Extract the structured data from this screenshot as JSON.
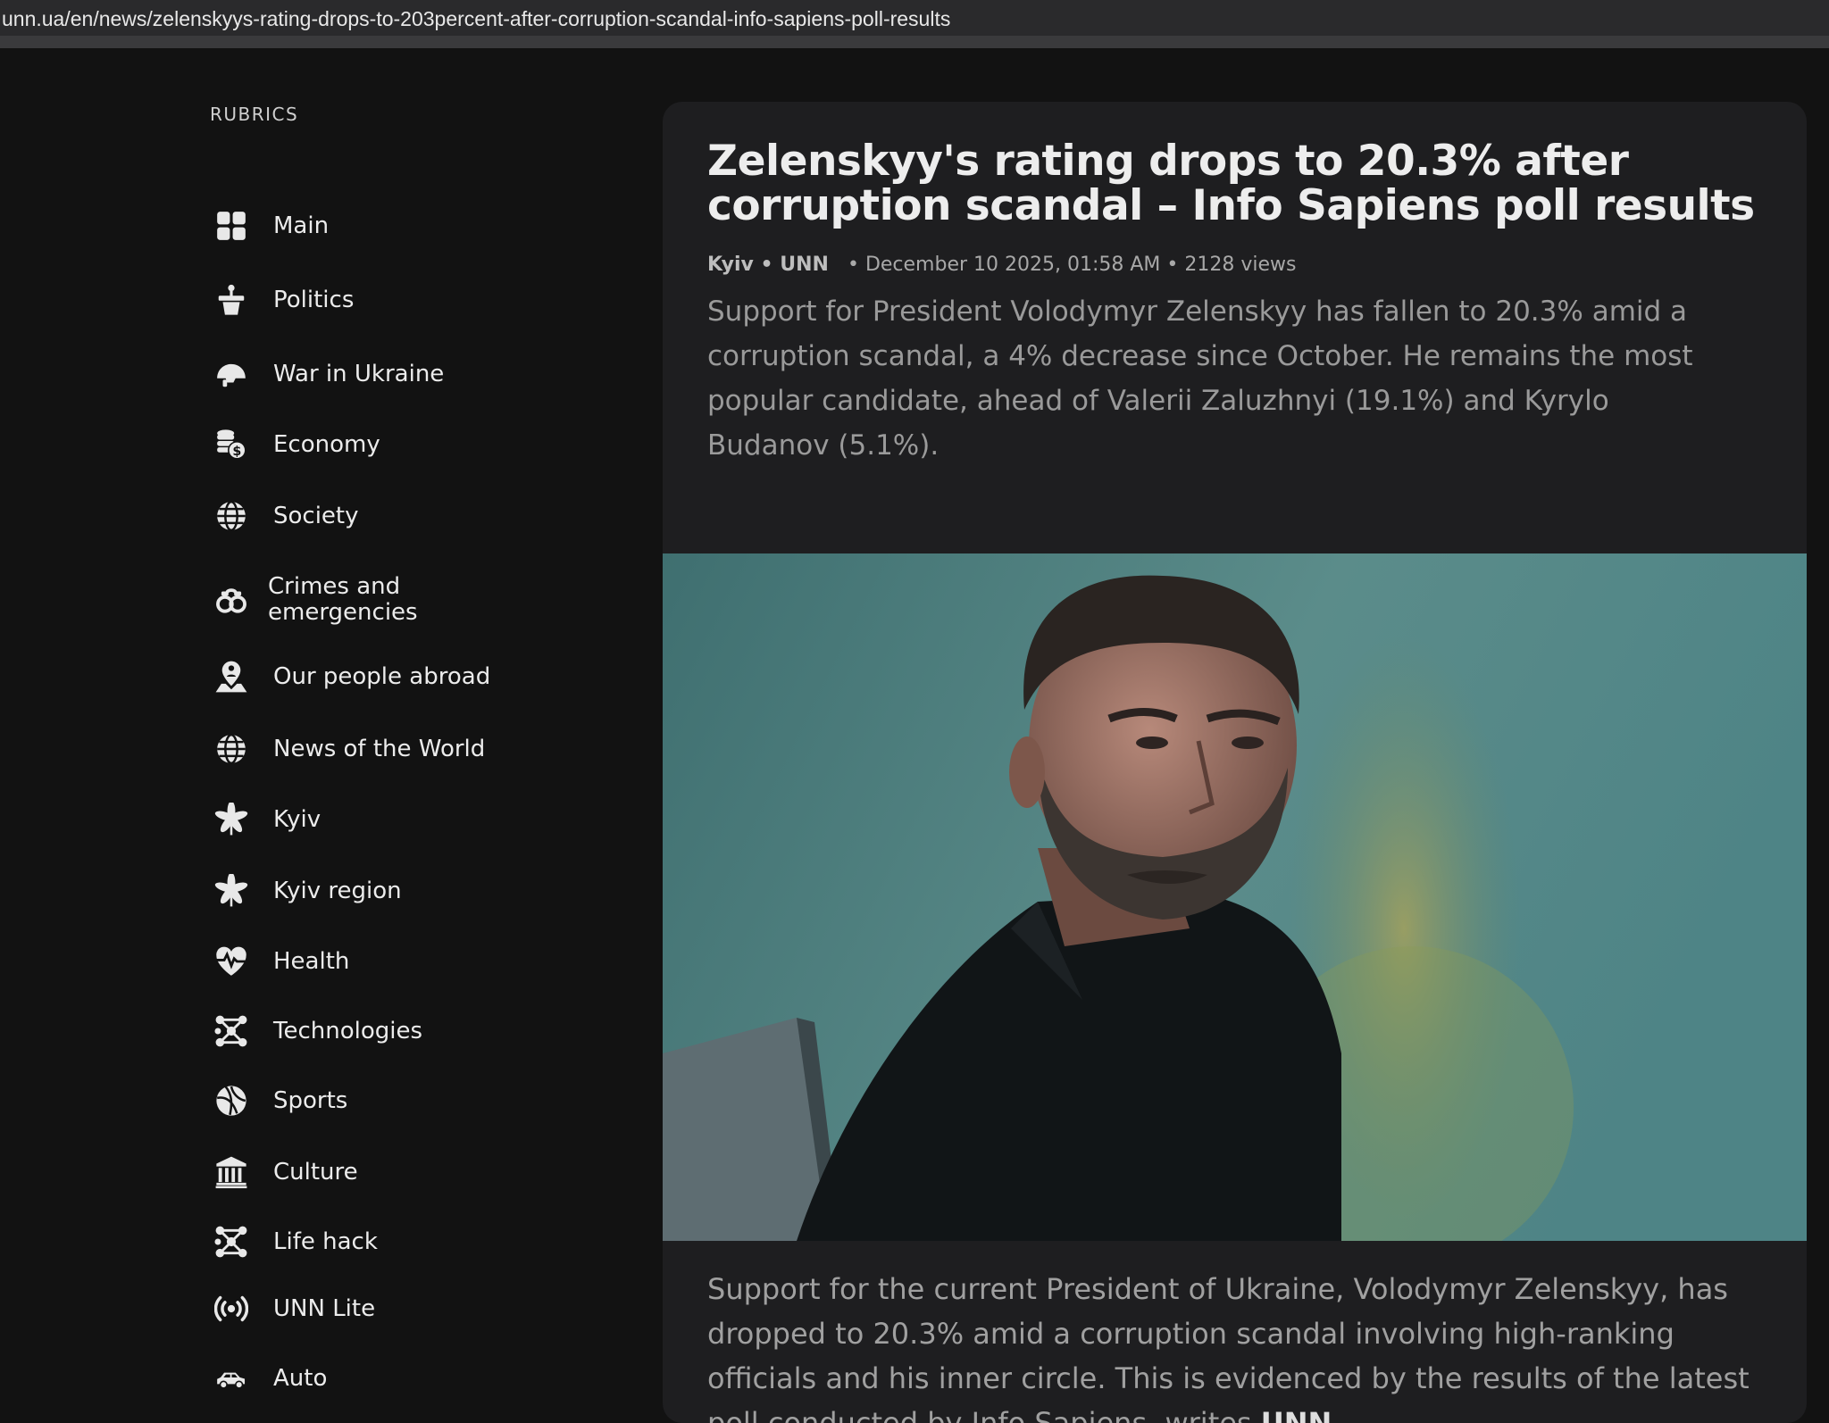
{
  "browser": {
    "url": "unn.ua/en/news/zelenskyys-rating-drops-to-203percent-after-corruption-scandal-info-sapiens-poll-results"
  },
  "sidebar": {
    "title": "RUBRICS",
    "items": [
      {
        "label": "Main",
        "icon": "grid-icon"
      },
      {
        "label": "Politics",
        "icon": "podium-icon"
      },
      {
        "label": "War in Ukraine",
        "icon": "helmet-icon"
      },
      {
        "label": "Economy",
        "icon": "coins-icon"
      },
      {
        "label": "Society",
        "icon": "globe-icon"
      },
      {
        "label": "Crimes and emergencies",
        "icon": "handcuffs-icon"
      },
      {
        "label": "Our people abroad",
        "icon": "location-person-icon"
      },
      {
        "label": "News of the World",
        "icon": "globe-icon"
      },
      {
        "label": "Kyiv",
        "icon": "chestnut-leaf-icon"
      },
      {
        "label": "Kyiv region",
        "icon": "chestnut-leaf-icon"
      },
      {
        "label": "Health",
        "icon": "heart-pulse-icon"
      },
      {
        "label": "Technologies",
        "icon": "network-icon"
      },
      {
        "label": "Sports",
        "icon": "basketball-icon"
      },
      {
        "label": "Culture",
        "icon": "museum-icon"
      },
      {
        "label": "Life hack",
        "icon": "network-icon"
      },
      {
        "label": "UNN Lite",
        "icon": "broadcast-icon"
      },
      {
        "label": "Auto",
        "icon": "car-icon"
      }
    ]
  },
  "article": {
    "title": "Zelenskyy's rating drops to 20.3% after corruption scandal – Info Sapiens poll results",
    "location": "Kyiv",
    "source": "UNN",
    "date": "December 10 2025, 01:58 AM",
    "views": "2128 views",
    "lead": "Support for President Volodymyr Zelenskyy has fallen to 20.3% amid a corruption scandal, a 4% decrease since October. He remains the most popular candidate, ahead of Valerii Zaluzhnyi (19.1%) and Kyrylo Budanov (5.1%).",
    "body_text": "Support for the current President of Ukraine, Volodymyr Zelenskyy, has dropped to 20.3% amid a corruption scandal involving high-ranking officials and his inner circle. This is evidenced by the results of the latest poll conducted by Info Sapiens, writes",
    "body_source": "UNN",
    "body_end": "."
  }
}
